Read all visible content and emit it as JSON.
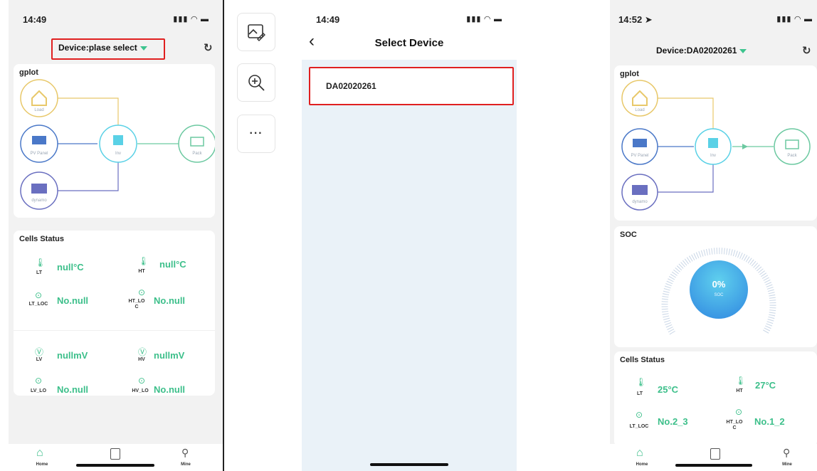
{
  "left_phone": {
    "time": "14:49",
    "device_label": "Device:plase select",
    "gplot_title": "gplot",
    "nodes": {
      "load": "Load",
      "pv": "PV Panel",
      "inv": "Inv",
      "pack": "Pack",
      "dynamo": "dynamo"
    },
    "cells_title": "Cells Status",
    "cells": [
      {
        "label": "LT",
        "value": "null°C"
      },
      {
        "label": "HT",
        "value": "null°C"
      },
      {
        "label": "LT_LOC",
        "value": "No.null"
      },
      {
        "label": "HT_LO C",
        "value": "No.null"
      },
      {
        "label": "LV",
        "value": "nullmV"
      },
      {
        "label": "HV",
        "value": "nullmV"
      },
      {
        "label": "LV_LO",
        "value": "No.null"
      },
      {
        "label": "HV_LO",
        "value": "No.null"
      }
    ],
    "tabs": [
      "Home",
      "",
      "Mine"
    ]
  },
  "toolbar": {
    "icons": [
      "image-edit-icon",
      "zoom-in-icon",
      "more-icon"
    ],
    "more_label": "···"
  },
  "middle_phone": {
    "time": "14:49",
    "title": "Select Device",
    "back": "‹",
    "devices": [
      "DA02020261"
    ]
  },
  "right_phone": {
    "time": "14:52",
    "device_label": "Device:DA02020261",
    "gplot_title": "gplot",
    "nodes": {
      "load": "Load",
      "pv": "PV Panel",
      "inv": "Inv",
      "pack": "Pack",
      "dynamo": "dynamo"
    },
    "soc_title": "SOC",
    "soc_value": "0%",
    "soc_sub": "SOC",
    "cells_title": "Cells Status",
    "cells": [
      {
        "label": "LT",
        "value": "25°C"
      },
      {
        "label": "HT",
        "value": "27°C"
      },
      {
        "label": "LT_LOC",
        "value": "No.2_3"
      },
      {
        "label": "HT_LO C",
        "value": "No.1_2"
      }
    ],
    "tabs": [
      "Home",
      "",
      "Mine"
    ]
  },
  "colors": {
    "accent_green": "#3cbf8a",
    "highlight_red": "#e02020",
    "inv_cyan": "#5ad1e6",
    "load_yellow": "#e8c86a",
    "pv_blue": "#4a78c8",
    "pack_green": "#6cc9a1",
    "dynamo_purple": "#6a6fc0"
  }
}
